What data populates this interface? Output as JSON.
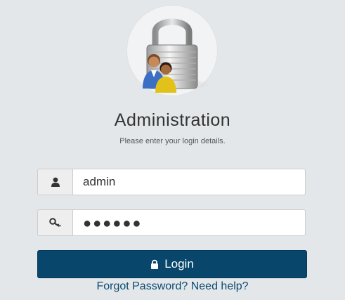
{
  "header": {
    "title": "Administration",
    "subtitle": "Please enter your login details."
  },
  "logo": {
    "icon": "padlock-users-icon"
  },
  "username": {
    "icon": "user-icon",
    "value": "admin"
  },
  "password": {
    "icon": "key-icon",
    "masked_value": "●●●●●●"
  },
  "login_button": {
    "icon": "lock-icon",
    "label": "Login"
  },
  "help_link": {
    "label": "Forgot Password? Need help?"
  },
  "colors": {
    "background": "#e4e7ea",
    "button": "#08476b",
    "link": "#0b4a6f"
  }
}
